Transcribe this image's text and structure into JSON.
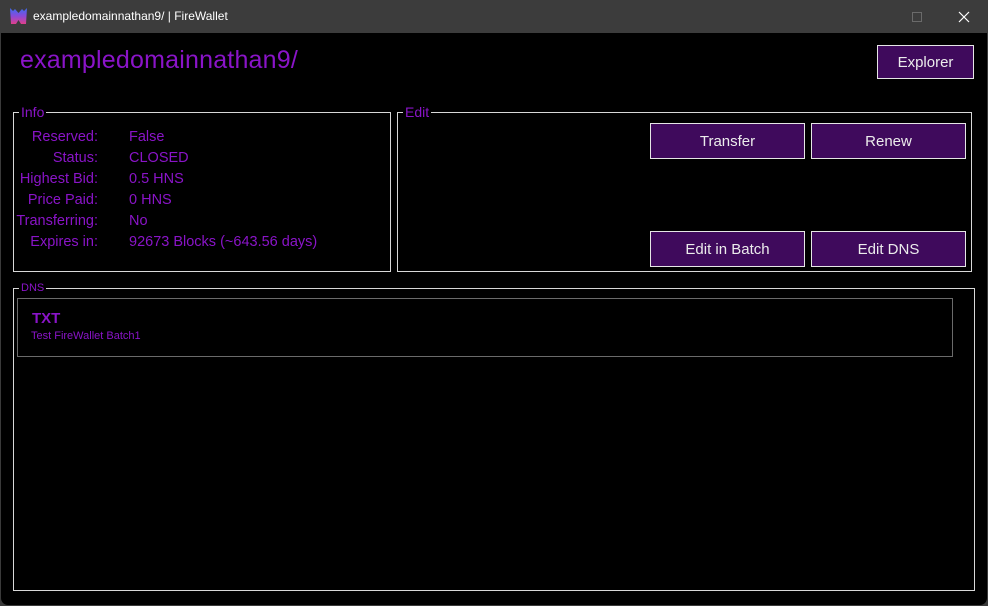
{
  "window": {
    "title": "exampledomainnathan9/ | FireWallet",
    "app_icon": "firewallet-logo-icon",
    "controls": [
      "minimize-icon",
      "maximize-icon",
      "close-icon"
    ]
  },
  "header": {
    "domain": "exampledomainnathan9/",
    "explorer_label": "Explorer"
  },
  "info": {
    "label": "Info",
    "rows": [
      {
        "label": "Reserved:",
        "value": "False"
      },
      {
        "label": "Status:",
        "value": "CLOSED"
      },
      {
        "label": "Highest Bid:",
        "value": "0.5 HNS"
      },
      {
        "label": "Price Paid:",
        "value": "0 HNS"
      },
      {
        "label": "Transferring:",
        "value": "No"
      },
      {
        "label": "Expires in:",
        "value": "92673 Blocks (~643.56 days)"
      }
    ]
  },
  "edit": {
    "label": "Edit",
    "transfer_label": "Transfer",
    "renew_label": "Renew",
    "edit_batch_label": "Edit in Batch",
    "edit_dns_label": "Edit DNS"
  },
  "dns": {
    "label": "DNS",
    "records": [
      {
        "type": "TXT",
        "value": "Test FireWallet Batch1"
      }
    ]
  },
  "colors": {
    "accent_text": "#8a14c8",
    "button_bg": "#3f0a5c",
    "background": "#000000"
  }
}
